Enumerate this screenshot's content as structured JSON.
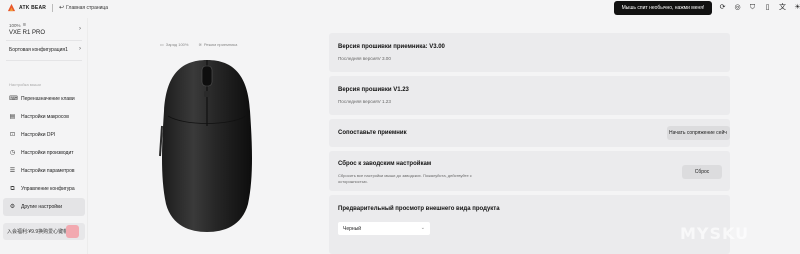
{
  "topbar": {
    "logo_text": "ATK BEAR",
    "home_label": "Главная страница",
    "hint_button": "Мышь спит необычно, нажми меня!"
  },
  "top_icons": [
    "refresh-icon",
    "user-icon",
    "shirt-icon",
    "battery-icon",
    "translate-icon",
    "sun-icon",
    "minimize-icon",
    "close-icon"
  ],
  "sidebar": {
    "battery": "100%",
    "device_name": "VXE R1 PRO",
    "config_label": "Бортовая конфигурация1",
    "section_label": "Настройка мыши",
    "items": [
      {
        "label": "Переназначение клави",
        "icon": "keyboard-icon"
      },
      {
        "label": "Настройки макросов",
        "icon": "macro-icon"
      },
      {
        "label": "Настройки DPI",
        "icon": "dpi-icon"
      },
      {
        "label": "Настройки производит",
        "icon": "performance-icon"
      },
      {
        "label": "Настройки параметров",
        "icon": "sliders-icon"
      },
      {
        "label": "Управление конфигура",
        "icon": "config-icon"
      },
      {
        "label": "Другие настройки",
        "icon": "settings-icon"
      }
    ],
    "promo_text": "入会福利:¥9.9换购爱心键帽"
  },
  "status": {
    "charge": "Заряд 100%",
    "mode": "Режим приемника"
  },
  "panels": {
    "receiver": {
      "title": "Версия прошивки приемника: V3.00",
      "sub": "Последняя версияV 3.00"
    },
    "firmware": {
      "title": "Версия прошивки V1.23",
      "sub": "Последняя версияV 1.23"
    },
    "pair": {
      "title": "Сопоставьте приемник",
      "button": "Начать сопряжение сейч"
    },
    "reset": {
      "title": "Сброс к заводским настройкам",
      "sub1": "Сбросить все настройки мыши до заводских. Пожалуйста, действуйте с",
      "sub2": "осторожностью.",
      "button": "Сброс"
    },
    "preview": {
      "title": "Предварительный просмотр внешнего вида продукта",
      "select_value": "Черный"
    }
  },
  "watermark": "MYSKU"
}
